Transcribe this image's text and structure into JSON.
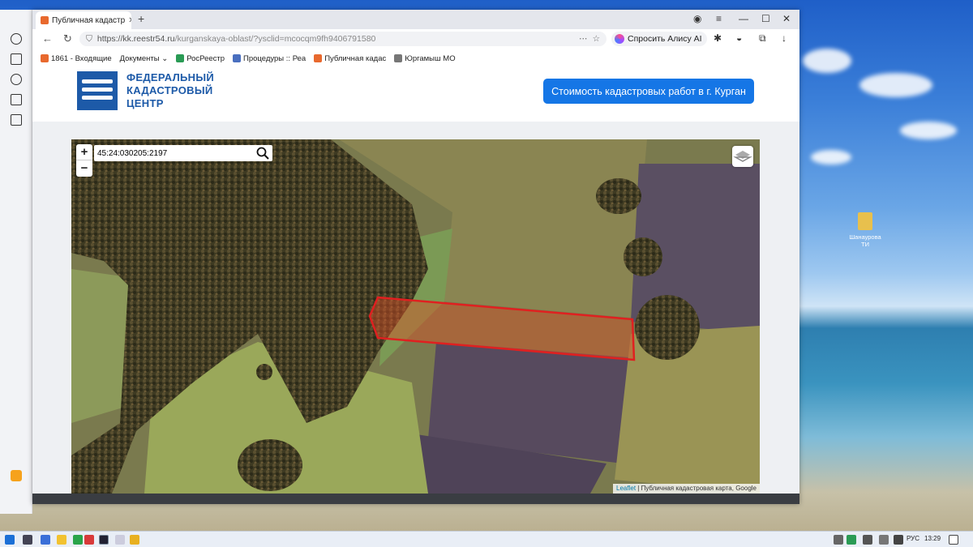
{
  "browser": {
    "tab_title": "Публичная кадастр",
    "url_host": "https://kk.reestr54.ru",
    "url_path": "/kurganskaya-oblast/?ysclid=mcocqm9fh9406791580",
    "alice_label": "Спросить Алису AI"
  },
  "bookmarks": [
    {
      "label": "1861 - Входящие",
      "color": "#e8692e"
    },
    {
      "label": "Документы ⌄",
      "color": ""
    },
    {
      "label": "РосРеестр",
      "color": "#2a9b55"
    },
    {
      "label": "Процедуры :: Реа",
      "color": "#4a6fbf"
    },
    {
      "label": "Публичная кадас",
      "color": "#e8692e"
    },
    {
      "label": "Юргамыш МО",
      "color": "#777777"
    }
  ],
  "site": {
    "logo_line1": "ФЕДЕРАЛЬНЫЙ",
    "logo_line2": "КАДАСТРОВЫЙ",
    "logo_line3": "ЦЕНТР",
    "cta_button": "Стоимость кадастровых работ в г. Курган",
    "brand_color": "#1d5aa8",
    "cta_color": "#1576e6"
  },
  "map": {
    "search_value": "45:24:030205:2197",
    "zoom_in": "+",
    "zoom_out": "−",
    "attribution_link": "Leaflet",
    "attribution_text": " | Публичная кадастровая карта, Google",
    "highlight_color": "#e02020"
  },
  "desktop": {
    "icon_label": "Шанаурова ТИ"
  },
  "taskbar": {
    "lang": "РУС",
    "time": "13:29"
  }
}
